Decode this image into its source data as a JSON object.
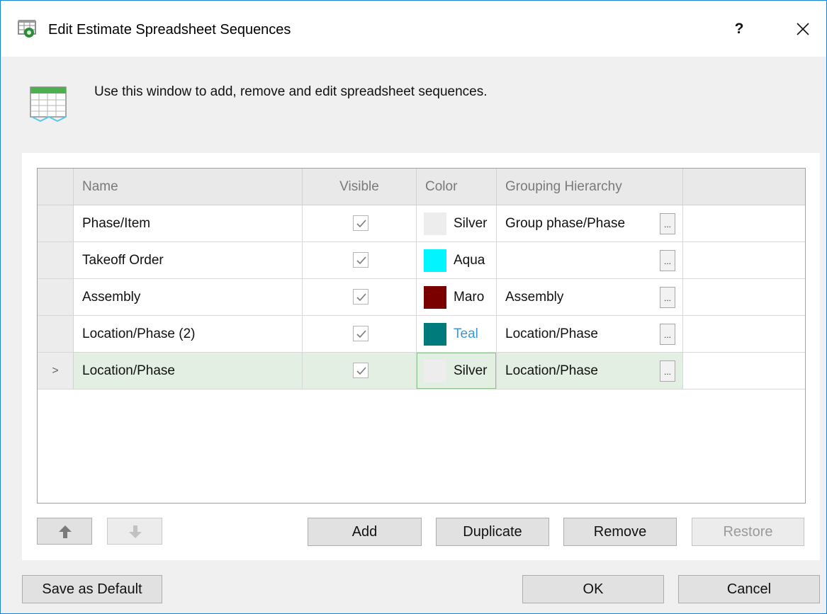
{
  "window": {
    "title": "Edit Estimate Spreadsheet Sequences",
    "help_label": "?",
    "title_icon": "spreadsheet-gear-icon",
    "close_icon": "close-icon"
  },
  "header": {
    "icon": "spreadsheet-grid-icon",
    "description": "Use this window to add, remove and edit spreadsheet sequences."
  },
  "grid": {
    "columns": {
      "name": "Name",
      "visible": "Visible",
      "color": "Color",
      "grouping": "Grouping Hierarchy"
    },
    "rows": [
      {
        "name": "Phase/Item",
        "visible": true,
        "color_name": "Silver",
        "color_hex": "#ededed",
        "grouping": "Group phase/Phase",
        "selected": false
      },
      {
        "name": "Takeoff Order",
        "visible": true,
        "color_name": "Aqua",
        "color_hex": "#00f5ff",
        "grouping": "",
        "selected": false
      },
      {
        "name": "Assembly",
        "visible": true,
        "color_name": "Maro",
        "color_hex": "#7a0000",
        "grouping": "Assembly",
        "selected": false
      },
      {
        "name": "Location/Phase (2)",
        "visible": true,
        "color_name": "Teal",
        "color_hex": "#007b7b",
        "grouping": "Location/Phase",
        "selected": false
      },
      {
        "name": "Location/Phase",
        "visible": true,
        "color_name": "Silver",
        "color_hex": "#ededed",
        "grouping": "Location/Phase",
        "selected": true
      }
    ],
    "current_row_marker": ">",
    "ellipsis_label": "..."
  },
  "toolbar": {
    "move_up_icon": "arrow-up-icon",
    "move_down_icon": "arrow-down-icon",
    "add_label": "Add",
    "duplicate_label": "Duplicate",
    "remove_label": "Remove",
    "restore_label": "Restore"
  },
  "footer": {
    "save_default_label": "Save as Default",
    "ok_label": "OK",
    "cancel_label": "Cancel"
  },
  "colors": {
    "selected_row": "#e4efe3",
    "link_text": "#3a96dd",
    "window_border": "#1883d7"
  }
}
